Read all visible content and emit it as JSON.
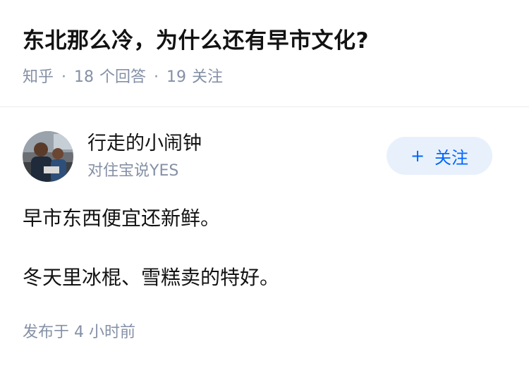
{
  "question": {
    "title": "东北那么冷，为什么还有早市文化?",
    "source": "知乎",
    "separator": "·",
    "answers_count": "18",
    "answers_label": "个回答",
    "followers_count": "19",
    "followers_label": "关注"
  },
  "author": {
    "name": "行走的小闹钟",
    "bio": "对住宝说YES",
    "avatar_icon": "user-avatar-photo"
  },
  "follow_button": {
    "icon": "+",
    "label": "关注"
  },
  "answer": {
    "paragraphs": [
      "早市东西便宜还新鲜。",
      "冬天里冰棍、雪糕卖的特好。"
    ],
    "publish_time": "发布于  4 小时前"
  },
  "colors": {
    "accent": "#0066ff",
    "follow_bg": "#e8f1fb",
    "meta_text": "#8590a6",
    "divider": "#ebebeb"
  }
}
